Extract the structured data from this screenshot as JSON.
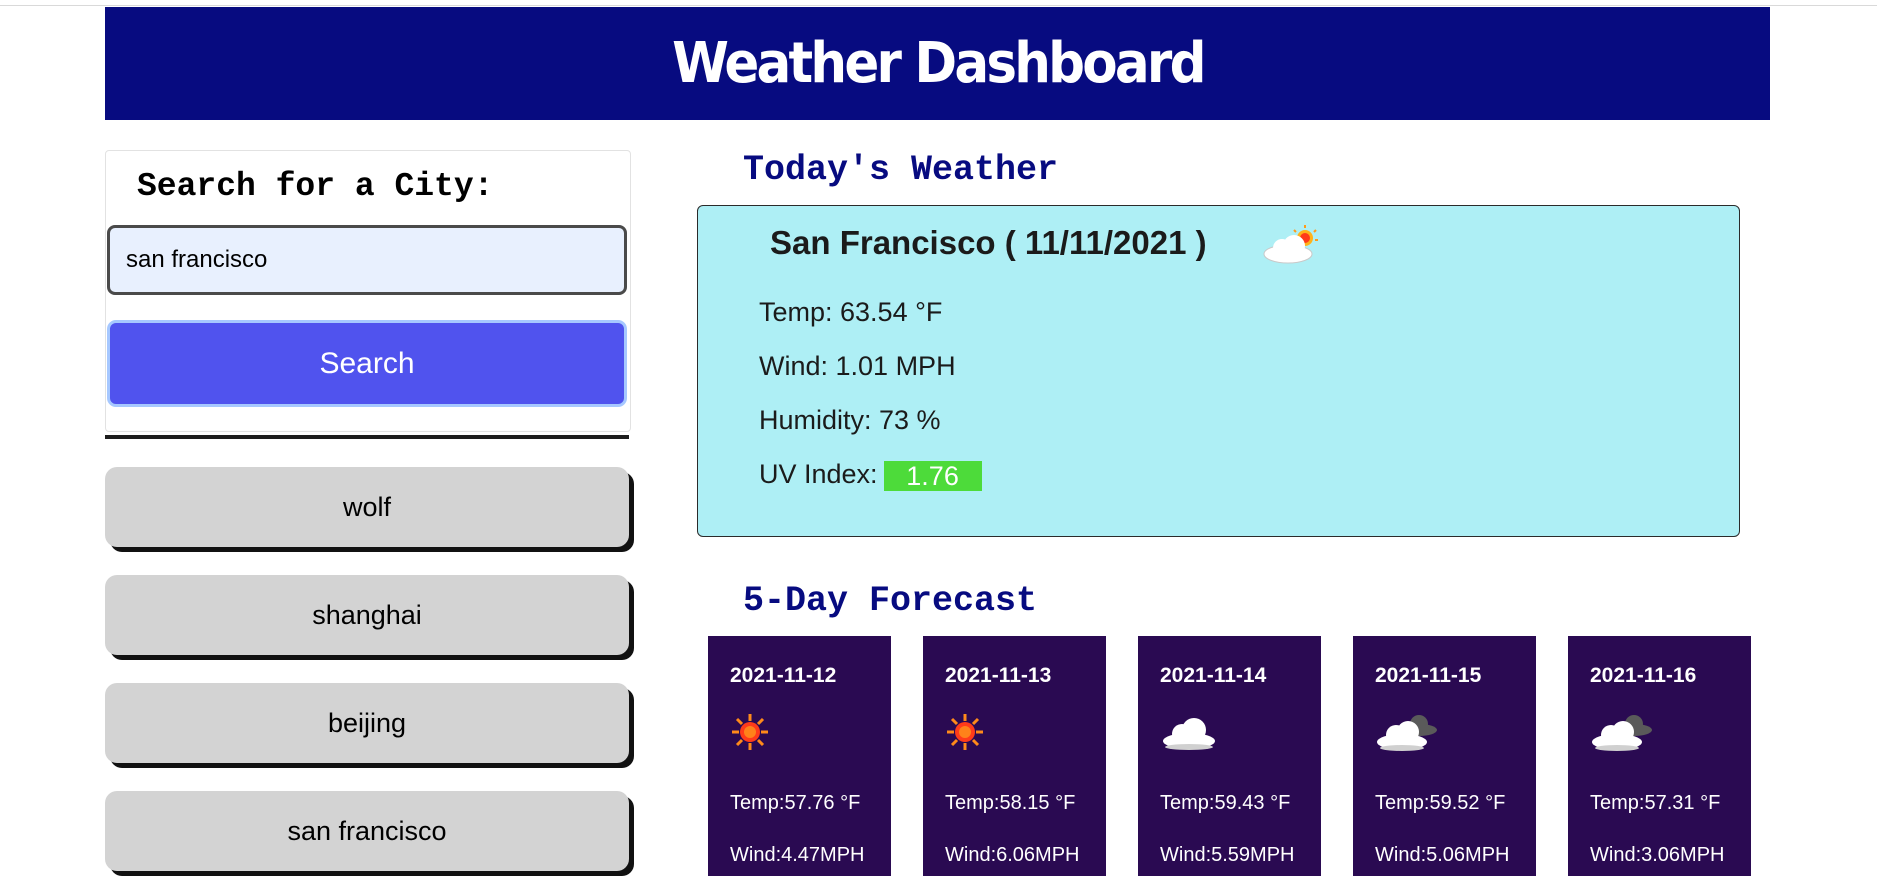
{
  "header": {
    "title": "Weather Dashboard",
    "color": "#070b80"
  },
  "search": {
    "title": "Search for a City:",
    "input_value": "san francisco",
    "button_label": "Search",
    "button_color": "#5053ee"
  },
  "history": [
    {
      "label": "wolf"
    },
    {
      "label": "shanghai"
    },
    {
      "label": "beijing"
    },
    {
      "label": "san francisco"
    }
  ],
  "today": {
    "section_title": "Today's Weather",
    "city_line": "San Francisco ( 11/11/2021 )",
    "icon": "partly-cloudy-day-icon",
    "temp": "Temp: 63.54 °F",
    "wind": "Wind: 1.01 MPH",
    "humidity": "Humidity: 73 %",
    "uv_label": "UV Index:",
    "uv_value": "1.76",
    "uv_color": "#4ddb3a",
    "card_color": "#aeeff5"
  },
  "forecast": {
    "section_title": "5-Day Forecast",
    "card_color": "#2a0a52",
    "days": [
      {
        "date": "2021-11-12",
        "icon": "sun-icon",
        "temp": "Temp:57.76 °F",
        "wind": "Wind:4.47MPH"
      },
      {
        "date": "2021-11-13",
        "icon": "sun-icon",
        "temp": "Temp:58.15 °F",
        "wind": "Wind:6.06MPH"
      },
      {
        "date": "2021-11-14",
        "icon": "cloud-icon",
        "temp": "Temp:59.43 °F",
        "wind": "Wind:5.59MPH"
      },
      {
        "date": "2021-11-15",
        "icon": "broken-clouds-icon",
        "temp": "Temp:59.52 °F",
        "wind": "Wind:5.06MPH"
      },
      {
        "date": "2021-11-16",
        "icon": "broken-clouds-icon",
        "temp": "Temp:57.31 °F",
        "wind": "Wind:3.06MPH"
      }
    ]
  }
}
